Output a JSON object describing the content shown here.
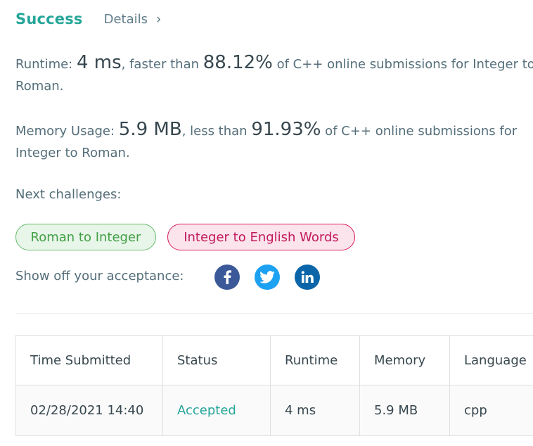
{
  "header": {
    "status": "Success",
    "details_label": "Details",
    "chevron": "›"
  },
  "runtime": {
    "prefix": "Runtime: ",
    "value": "4 ms",
    "middle": ", faster than ",
    "percent": "88.12%",
    "suffix": " of C++ online submissions for Integer to Roman."
  },
  "memory": {
    "prefix": "Memory Usage: ",
    "value": "5.9 MB",
    "middle": ", less than ",
    "percent": "91.93%",
    "suffix": " of C++ online submissions for Integer to Roman."
  },
  "next": {
    "label": "Next challenges:",
    "challenges": [
      "Roman to Integer",
      "Integer to English Words"
    ]
  },
  "share": {
    "label": "Show off your acceptance:",
    "icons": [
      "facebook-icon",
      "twitter-icon",
      "linkedin-icon"
    ]
  },
  "table": {
    "headers": [
      "Time Submitted",
      "Status",
      "Runtime",
      "Memory",
      "Language"
    ],
    "rows": [
      [
        "02/28/2021 14:40",
        "Accepted",
        "4 ms",
        "5.9 MB",
        "cpp"
      ]
    ]
  },
  "colors": {
    "success": "#26a69a",
    "chip_green": "#43a047",
    "chip_pink": "#c2185b",
    "facebook": "#3b5998",
    "twitter": "#1da1f2",
    "linkedin": "#0a66a8"
  }
}
